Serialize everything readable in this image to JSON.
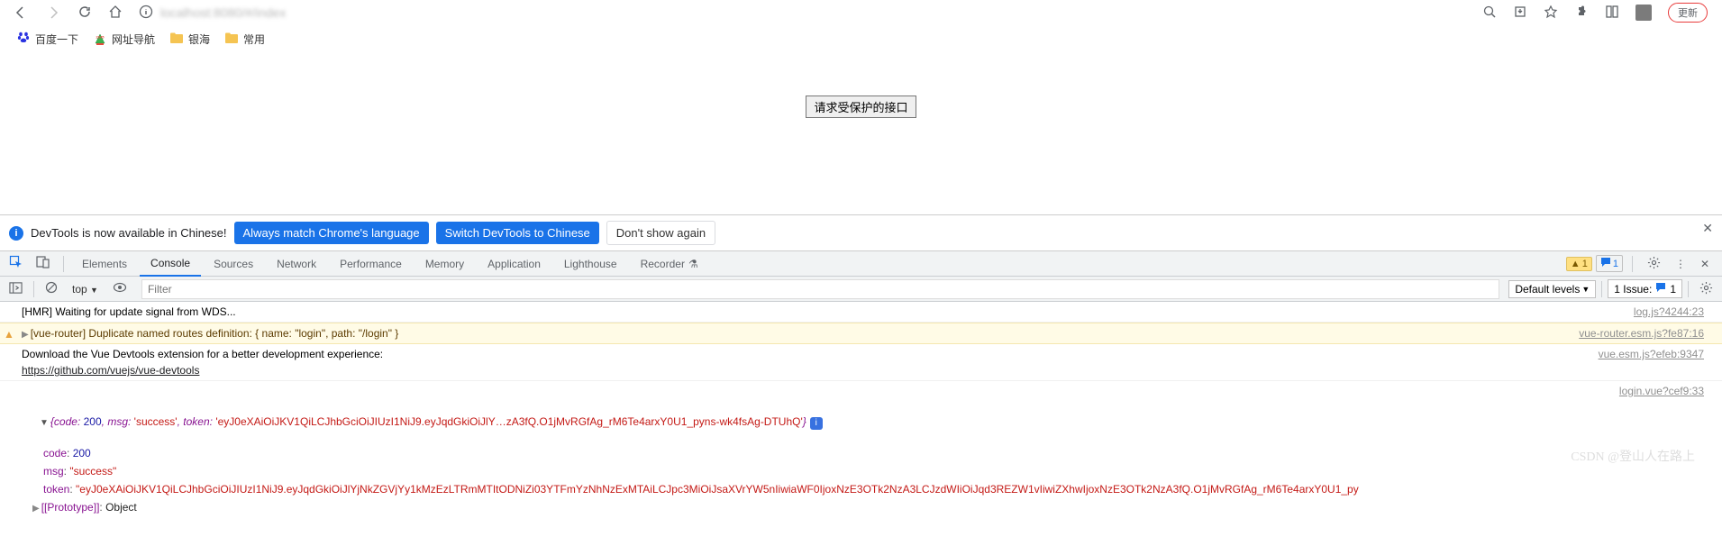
{
  "browser": {
    "url": "localhost:8080/#/index",
    "update_label": "更新"
  },
  "bookmarks": [
    {
      "name": "百度一下",
      "icon": "baidu"
    },
    {
      "name": "网址导航",
      "icon": "2345"
    },
    {
      "name": "银海",
      "icon": "folder"
    },
    {
      "name": "常用",
      "icon": "folder"
    }
  ],
  "page": {
    "button_label": "请求受保护的接口"
  },
  "devtools_notify": {
    "text": "DevTools is now available in Chinese!",
    "btn1": "Always match Chrome's language",
    "btn2": "Switch DevTools to Chinese",
    "btn3": "Don't show again"
  },
  "devtools_tabs": {
    "tabs": [
      "Elements",
      "Console",
      "Sources",
      "Network",
      "Performance",
      "Memory",
      "Application",
      "Lighthouse",
      "Recorder"
    ],
    "active": "Console",
    "warn_count": "1",
    "chat_count": "1"
  },
  "console_toolbar": {
    "context": "top",
    "filter_placeholder": "Filter",
    "levels": "Default levels",
    "issues_label": "1 Issue:",
    "issues_count": "1"
  },
  "logs": {
    "hmr": {
      "msg": "[HMR] Waiting for update signal from WDS...",
      "src": "log.js?4244:23"
    },
    "router": {
      "msg": "[vue-router] Duplicate named routes definition: { name: \"login\", path: \"/login\" }",
      "src": "vue-router.esm.js?fe87:16"
    },
    "vuedev": {
      "l1": "Download the Vue Devtools extension for a better development experience:",
      "l2": "https://github.com/vuejs/vue-devtools",
      "src": "vue.esm.js?efeb:9347"
    },
    "login_src": "login.vue?cef9:33",
    "obj_preview_pre": "{code: ",
    "obj_preview_code": "200",
    "obj_preview_msg_k": ", msg: ",
    "obj_preview_msg_v": "'success'",
    "obj_preview_tok_k": ", token: ",
    "obj_preview_tok_v": "'eyJ0eXAiOiJKV1QiLCJhbGciOiJIUzI1NiJ9.eyJqdGkiOiJlY…zA3fQ.O1jMvRGfAg_rM6Te4arxY0U1_pyns-wk4fsAg-DTUhQ'",
    "obj_preview_end": "}",
    "code_k": "code",
    "code_v": "200",
    "msg_k": "msg",
    "msg_v": "\"success\"",
    "token_k": "token",
    "token_v": "\"eyJ0eXAiOiJKV1QiLCJhbGciOiJIUzI1NiJ9.eyJqdGkiOiJlYjNkZGVjYy1kMzEzLTRmMTItODNiZi03YTFmYzNhNzExMTAiLCJpc3MiOiJsaXVrYW5nIiwiaWF0IjoxNzE3OTk2NzA3LCJzdWIiOiJqd3REZW1vIiwiZXhwIjoxNzE3OTk2NzA3fQ.O1jMvRGfAg_rM6Te4arxY0U1_py",
    "proto_k": "[[Prototype]]",
    "proto_v": "Object"
  },
  "watermark": "CSDN @登山人在路上"
}
